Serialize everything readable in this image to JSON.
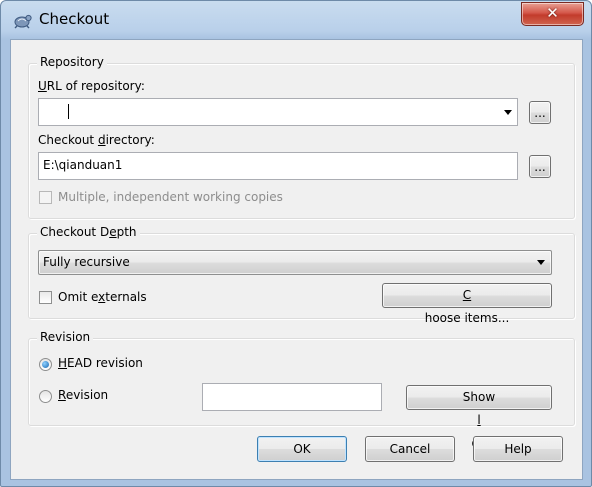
{
  "window": {
    "title": "Checkout",
    "close_label": "✕"
  },
  "repository": {
    "group_title": "Repository",
    "url_label_prefix": "U",
    "url_label_rest": "RL of repository:",
    "url_value": "",
    "browse_url_label": "...",
    "dir_label_prefix": "Checkout ",
    "dir_label_hotkey": "d",
    "dir_label_rest": "irectory:",
    "dir_value": "E:\\qianduan1",
    "browse_dir_label": "...",
    "multiple_wc_label": "Multiple, independent working copies",
    "multiple_wc_checked": false,
    "multiple_wc_enabled": false
  },
  "depth": {
    "group_title_prefix": "Checkout D",
    "group_title_hotkey": "e",
    "group_title_rest": "pth",
    "selected": "Fully recursive",
    "omit_prefix": "Omit e",
    "omit_hotkey": "x",
    "omit_rest": "ternals",
    "omit_checked": false,
    "choose_prefix": "",
    "choose_hotkey": "C",
    "choose_rest": "hoose items..."
  },
  "revision": {
    "group_title": "Revision",
    "head_hotkey": "H",
    "head_rest": "EAD revision",
    "head_selected": true,
    "rev_hotkey": "R",
    "rev_rest": "evision",
    "rev_value": "",
    "show_log_prefix": "Show ",
    "show_log_hotkey": "l",
    "show_log_rest": "og"
  },
  "buttons": {
    "ok": "OK",
    "cancel": "Cancel",
    "help": "Help"
  },
  "colors": {
    "title_bar": "#b9d0ea",
    "close_button": "#c23b2c",
    "dialog_bg": "#f0f0f0",
    "default_button_border": "#3c7fb1",
    "disabled_text": "#8d8d8d"
  }
}
